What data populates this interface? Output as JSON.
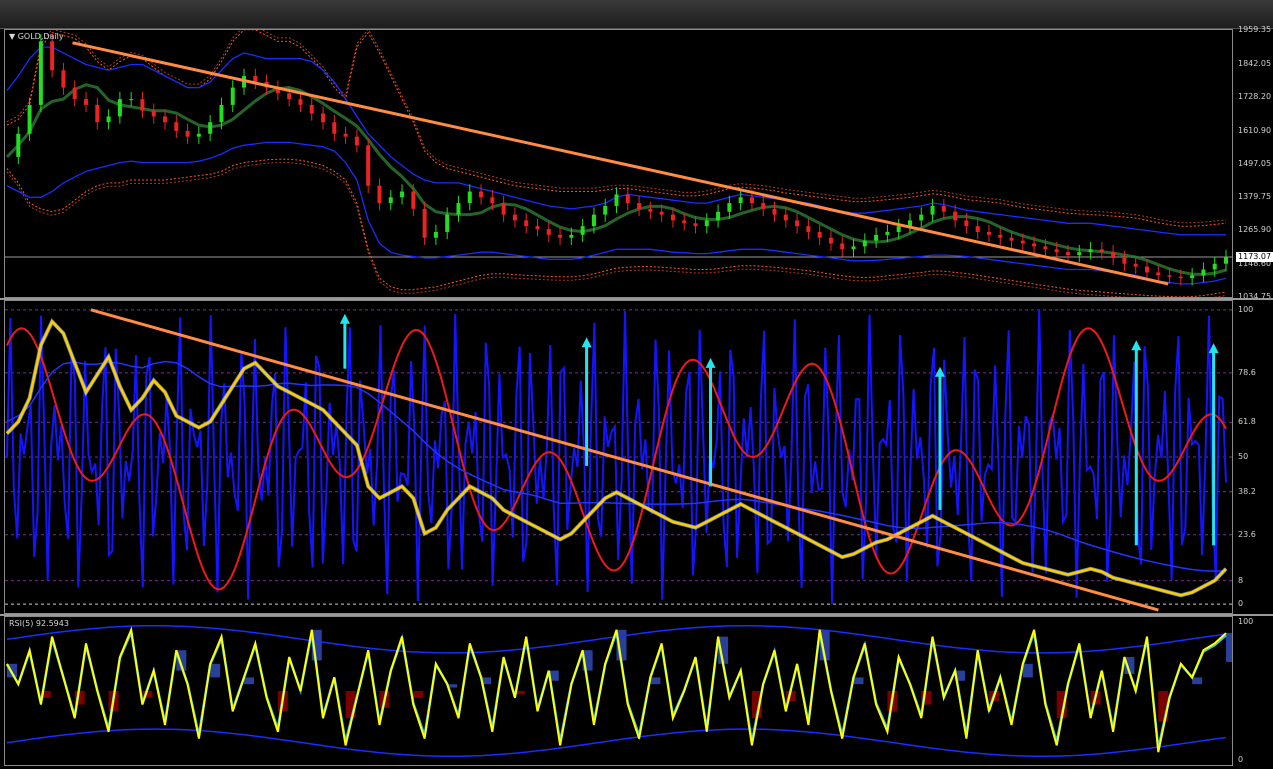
{
  "chart_data": [
    {
      "type": "line",
      "symbol_label": "GOLD,Daily",
      "ylim": [
        1034.75,
        1959.35
      ],
      "ticks": [
        "1959.35",
        "1842.05",
        "1728.20",
        "1610.90",
        "1497.05",
        "1379.75",
        "1265.90",
        "1148.60",
        "1034.75"
      ],
      "current_price": "1173.07",
      "current_price_value": 1173.07,
      "series": [
        {
          "values": [
            1520,
            1600,
            1700,
            1920,
            1820,
            1760,
            1720,
            1700,
            1640,
            1660,
            1720,
            1720,
            1680,
            1660,
            1640,
            1610,
            1590,
            1600,
            1640,
            1700,
            1760,
            1800,
            1780,
            1760,
            1740,
            1720,
            1700,
            1670,
            1640,
            1600,
            1590,
            1560,
            1420,
            1360,
            1380,
            1400,
            1340,
            1240,
            1260,
            1320,
            1360,
            1400,
            1380,
            1360,
            1320,
            1300,
            1280,
            1270,
            1250,
            1240,
            1250,
            1280,
            1320,
            1350,
            1390,
            1360,
            1340,
            1330,
            1320,
            1300,
            1290,
            1280,
            1300,
            1330,
            1360,
            1380,
            1360,
            1340,
            1320,
            1300,
            1280,
            1260,
            1240,
            1220,
            1200,
            1210,
            1230,
            1250,
            1260,
            1280,
            1300,
            1320,
            1350,
            1330,
            1300,
            1280,
            1260,
            1250,
            1240,
            1230,
            1220,
            1210,
            1200,
            1190,
            1180,
            1190,
            1200,
            1190,
            1170,
            1150,
            1140,
            1120,
            1110,
            1105,
            1100,
            1110,
            1130,
            1150,
            1173
          ],
          "color": "#22cc22"
        }
      ],
      "bollinger_upper_blue": [
        1750,
        1800,
        1860,
        1900,
        1900,
        1880,
        1860,
        1840,
        1830,
        1820,
        1830,
        1840,
        1840,
        1820,
        1800,
        1780,
        1760,
        1760,
        1780,
        1820,
        1860,
        1880,
        1870,
        1860,
        1860,
        1860,
        1860,
        1850,
        1820,
        1780,
        1720,
        1660,
        1600,
        1560,
        1520,
        1490,
        1460,
        1440,
        1430,
        1430,
        1430,
        1420,
        1410,
        1400,
        1390,
        1380,
        1370,
        1360,
        1350,
        1345,
        1340,
        1345,
        1350,
        1360,
        1380,
        1390,
        1385,
        1380,
        1375,
        1370,
        1365,
        1360,
        1360,
        1370,
        1380,
        1390,
        1385,
        1380,
        1375,
        1370,
        1365,
        1360,
        1350,
        1340,
        1330,
        1325,
        1325,
        1330,
        1335,
        1340,
        1345,
        1350,
        1360,
        1355,
        1345,
        1335,
        1330,
        1325,
        1320,
        1315,
        1310,
        1305,
        1300,
        1295,
        1290,
        1290,
        1290,
        1285,
        1280,
        1275,
        1270,
        1265,
        1260,
        1255,
        1250,
        1250,
        1250,
        1250,
        1250
      ],
      "bollinger_lower_blue": [
        1420,
        1400,
        1380,
        1380,
        1400,
        1430,
        1450,
        1470,
        1480,
        1490,
        1500,
        1505,
        1500,
        1500,
        1500,
        1500,
        1500,
        1505,
        1515,
        1530,
        1550,
        1560,
        1565,
        1570,
        1570,
        1570,
        1565,
        1560,
        1555,
        1540,
        1500,
        1440,
        1300,
        1220,
        1190,
        1180,
        1175,
        1170,
        1170,
        1175,
        1180,
        1185,
        1190,
        1190,
        1185,
        1180,
        1175,
        1170,
        1165,
        1165,
        1165,
        1170,
        1180,
        1190,
        1200,
        1200,
        1200,
        1200,
        1195,
        1190,
        1188,
        1185,
        1185,
        1190,
        1195,
        1200,
        1200,
        1200,
        1195,
        1190,
        1185,
        1180,
        1175,
        1170,
        1165,
        1160,
        1160,
        1162,
        1165,
        1168,
        1172,
        1175,
        1180,
        1180,
        1178,
        1175,
        1170,
        1165,
        1160,
        1155,
        1150,
        1145,
        1140,
        1135,
        1130,
        1130,
        1130,
        1125,
        1120,
        1115,
        1110,
        1100,
        1090,
        1085,
        1080,
        1080,
        1085,
        1090,
        1100
      ],
      "envelope_upper_red": [
        1630,
        1650,
        1700,
        1900,
        1950,
        1940,
        1930,
        1900,
        1850,
        1820,
        1850,
        1870,
        1860,
        1830,
        1800,
        1780,
        1760,
        1760,
        1790,
        1850,
        1920,
        1960,
        1960,
        1940,
        1920,
        1920,
        1900,
        1860,
        1820,
        1760,
        1720,
        1900,
        1950,
        1880,
        1800,
        1720,
        1640,
        1540,
        1500,
        1480,
        1470,
        1460,
        1450,
        1440,
        1430,
        1420,
        1415,
        1410,
        1405,
        1400,
        1400,
        1400,
        1400,
        1405,
        1410,
        1410,
        1405,
        1400,
        1395,
        1390,
        1385,
        1385,
        1390,
        1400,
        1410,
        1415,
        1412,
        1408,
        1402,
        1395,
        1390,
        1385,
        1380,
        1375,
        1370,
        1365,
        1365,
        1368,
        1372,
        1376,
        1380,
        1386,
        1392,
        1388,
        1380,
        1372,
        1368,
        1364,
        1360,
        1352,
        1345,
        1340,
        1335,
        1330,
        1325,
        1322,
        1320,
        1318,
        1315,
        1312,
        1308,
        1300,
        1292,
        1285,
        1280,
        1280,
        1282,
        1286,
        1290
      ],
      "envelope_lower_red": [
        1480,
        1430,
        1360,
        1340,
        1330,
        1340,
        1370,
        1400,
        1420,
        1430,
        1430,
        1440,
        1440,
        1440,
        1440,
        1445,
        1450,
        1455,
        1460,
        1470,
        1490,
        1500,
        1505,
        1510,
        1512,
        1512,
        1508,
        1500,
        1490,
        1470,
        1440,
        1360,
        1200,
        1100,
        1070,
        1060,
        1060,
        1065,
        1070,
        1080,
        1090,
        1100,
        1110,
        1115,
        1115,
        1112,
        1110,
        1108,
        1106,
        1105,
        1105,
        1108,
        1115,
        1125,
        1135,
        1138,
        1140,
        1140,
        1138,
        1135,
        1133,
        1130,
        1130,
        1133,
        1138,
        1143,
        1143,
        1141,
        1138,
        1134,
        1130,
        1126,
        1120,
        1114,
        1108,
        1104,
        1102,
        1104,
        1108,
        1112,
        1116,
        1120,
        1125,
        1124,
        1120,
        1116,
        1110,
        1104,
        1098,
        1092,
        1086,
        1080,
        1074,
        1068,
        1062,
        1058,
        1055,
        1052,
        1049,
        1046,
        1043,
        1040,
        1038,
        1036,
        1035,
        1036,
        1040,
        1046,
        1052
      ],
      "trendline": {
        "from": [
          0.055,
          1915
        ],
        "to": [
          0.948,
          1080
        ],
        "color": "#ff8c42"
      }
    },
    {
      "type": "line",
      "ylim": [
        -3,
        103
      ],
      "ticks": [
        "100",
        "78.6",
        "61.8",
        "50",
        "38.2",
        "23.6",
        "8",
        "0"
      ],
      "tick_values": [
        100,
        78.6,
        61.8,
        50,
        38.2,
        23.6,
        8,
        0
      ],
      "series": [
        {
          "values": [
            58,
            62,
            70,
            88,
            96,
            92,
            82,
            72,
            78,
            84,
            74,
            66,
            70,
            76,
            72,
            64,
            62,
            60,
            62,
            68,
            74,
            80,
            82,
            78,
            74,
            72,
            70,
            68,
            66,
            62,
            58,
            54,
            40,
            36,
            38,
            40,
            36,
            24,
            26,
            32,
            36,
            40,
            38,
            36,
            32,
            30,
            28,
            26,
            24,
            22,
            24,
            28,
            32,
            36,
            38,
            36,
            34,
            32,
            30,
            28,
            27,
            26,
            28,
            30,
            32,
            34,
            32,
            30,
            28,
            26,
            24,
            22,
            20,
            18,
            16,
            17,
            19,
            21,
            22,
            24,
            26,
            28,
            30,
            28,
            26,
            24,
            22,
            20,
            18,
            16,
            14,
            13,
            12,
            11,
            10,
            11,
            12,
            11,
            9,
            8,
            7,
            6,
            5,
            4,
            3,
            4,
            6,
            8,
            12
          ],
          "color": "#ffcc00"
        }
      ],
      "arrows": [
        {
          "x": 0.277,
          "from": 80,
          "to": 98
        },
        {
          "x": 0.474,
          "from": 47,
          "to": 90
        },
        {
          "x": 0.575,
          "from": 40,
          "to": 83
        },
        {
          "x": 0.762,
          "from": 32,
          "to": 80
        },
        {
          "x": 0.922,
          "from": 20,
          "to": 89
        },
        {
          "x": 0.985,
          "from": 20,
          "to": 88
        }
      ],
      "trendline": {
        "from": [
          0.07,
          100
        ],
        "to": [
          0.94,
          -2
        ],
        "color": "#ff8c42"
      }
    },
    {
      "type": "line",
      "label": "RSI(5) 92.5943",
      "ylim": [
        0,
        100
      ],
      "ticks": [
        "100",
        "0"
      ],
      "tick_values": [
        100,
        0
      ],
      "series": [
        {
          "values": [
            70,
            55,
            80,
            40,
            90,
            60,
            30,
            85,
            50,
            20,
            75,
            95,
            40,
            65,
            25,
            80,
            55,
            15,
            70,
            90,
            35,
            60,
            85,
            45,
            20,
            75,
            50,
            95,
            30,
            60,
            10,
            45,
            80,
            25,
            65,
            90,
            40,
            15,
            70,
            55,
            30,
            85,
            60,
            20,
            75,
            45,
            90,
            35,
            65,
            10,
            55,
            80,
            25,
            70,
            95,
            40,
            15,
            60,
            85,
            30,
            50,
            75,
            20,
            90,
            45,
            65,
            10,
            55,
            80,
            35,
            70,
            25,
            95,
            50,
            15,
            60,
            85,
            40,
            20,
            75,
            55,
            30,
            90,
            45,
            65,
            15,
            80,
            35,
            60,
            25,
            70,
            95,
            40,
            10,
            55,
            85,
            30,
            65,
            20,
            75,
            50,
            90,
            5,
            45,
            70,
            60,
            80,
            85,
            92.59
          ],
          "color": "#ffff00"
        }
      ]
    }
  ]
}
